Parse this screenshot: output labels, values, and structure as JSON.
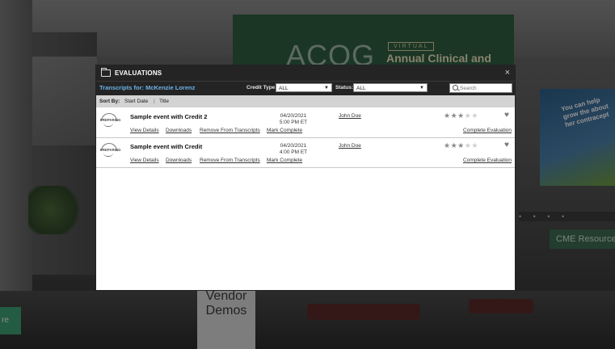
{
  "background": {
    "banner_logo": "ACOG",
    "banner_virtual": "VIRTUAL",
    "banner_title": "Annual Clinical and",
    "billboard_text": "You can help grow the about her contracept",
    "cme_sign": "CME Resource",
    "vendor_sign_line1": "Vendor",
    "vendor_sign_line2": "Demos",
    "left_tab": "re"
  },
  "modal": {
    "title": "EVALUATIONS",
    "close_glyph": "×",
    "transcripts_for": "Transcripts for: McKenzie Lorenz",
    "credit_type_label": "Credit Type:",
    "credit_type_value": "ALL",
    "status_label": "Status:",
    "status_value": "ALL",
    "search_placeholder": "Search",
    "sort": {
      "label": "Sort By:",
      "options": [
        "Start Date",
        "Title"
      ],
      "separator": "|"
    },
    "rows": [
      {
        "logo_text": "PREPARING",
        "name": "Sample event with Credit 2",
        "date": "04/20/2021",
        "time": "5:00 PM ET",
        "user": "John Doe",
        "links": [
          "View Details",
          "Downloads",
          "Remove From Transcripts",
          "Mark Complete"
        ],
        "rating": 3,
        "rating_max": 5,
        "action": "Complete Evaluation"
      },
      {
        "logo_text": "PREPARING",
        "name": "Sample event with Credit",
        "date": "04/20/2021",
        "time": "4:00 PM ET",
        "user": "John Doe",
        "links": [
          "View Details",
          "Downloads",
          "Remove From Transcripts",
          "Mark Complete"
        ],
        "rating": 3,
        "rating_max": 5,
        "action": "Complete Evaluation"
      }
    ]
  },
  "colors": {
    "header_bg": "#242424",
    "transcripts_link": "#6cb2e8",
    "sort_bar_bg": "#d3d3d3"
  },
  "icons": [
    "folder-icon",
    "close-icon",
    "search-icon",
    "chevron-down-icon",
    "star-icon",
    "heart-plus-icon",
    "preparing-logo"
  ]
}
